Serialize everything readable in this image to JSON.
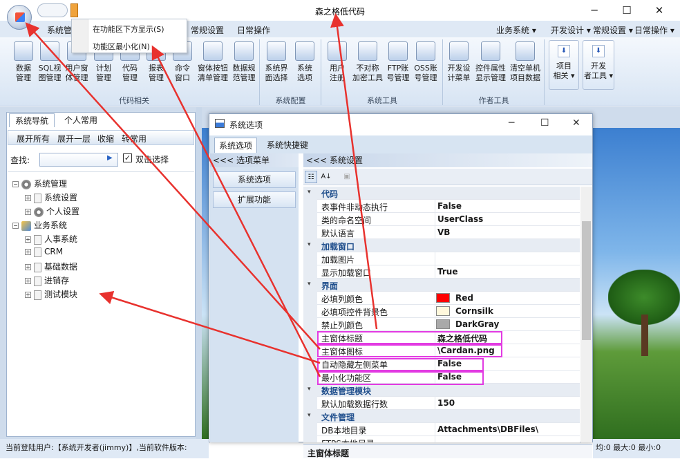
{
  "window": {
    "title": "森之格低代码",
    "minimize": "─",
    "maximize": "☐",
    "close": "✕"
  },
  "popup_menu": [
    "在功能区下方显示(S)",
    "功能区最小化(N)"
  ],
  "ribbon_tabs": [
    "系统管",
    "常规设置",
    "日常操作"
  ],
  "ribbon_right": [
    "业务系统 ▾",
    "开发设计 ▾",
    "常规设置 ▾",
    "日常操作 ▾"
  ],
  "groups": [
    {
      "label": "代码相关",
      "buttons": [
        "数据\n管理",
        "SQL视\n图管理",
        "用户窗\n体管理",
        "计划\n管理",
        "代码\n管理",
        "报表\n管理",
        "命令\n窗口",
        "窗体按钮\n清单管理",
        "数据规\n范管理"
      ]
    },
    {
      "label": "系统配置",
      "buttons": [
        "系统界\n面选择",
        "系统\n选项"
      ]
    },
    {
      "label": "系统工具",
      "buttons": [
        "用户\n注册",
        "不对称\n加密工具",
        "FTP账\n号管理",
        "OSS账\n号管理"
      ]
    },
    {
      "label": "作者工具",
      "buttons": [
        "开发设\n计菜单",
        "控件属性\n显示管理",
        "清空单机\n项目数据"
      ]
    }
  ],
  "big_buttons": [
    "项目\n相关 ▾",
    "开发\n者工具 ▾"
  ],
  "left_tabs": [
    "系统导航",
    "个人常用"
  ],
  "nav_buttons": [
    "展开所有",
    "展开一层",
    "收缩",
    "转常用"
  ],
  "find_label": "查找:",
  "dblclick_label": "双击选择",
  "tree": [
    {
      "label": "系统管理",
      "level": 0,
      "icon": "gear"
    },
    {
      "label": "系统设置",
      "level": 1,
      "icon": "doc"
    },
    {
      "label": "个人设置",
      "level": 1,
      "icon": "gear"
    },
    {
      "label": "业务系统",
      "level": 0,
      "icon": "biz"
    },
    {
      "label": "人事系统",
      "level": 1,
      "icon": "doc"
    },
    {
      "label": "CRM",
      "level": 1,
      "icon": "doc"
    },
    {
      "label": "基础数据",
      "level": 1,
      "icon": "doc"
    },
    {
      "label": "进销存",
      "level": 1,
      "icon": "doc"
    },
    {
      "label": "测试模块",
      "level": 1,
      "icon": "doc"
    }
  ],
  "dialog": {
    "title": "系统选项",
    "tabs": [
      "系统选项",
      "系统快捷键"
    ],
    "menu_header": "<<< 选项菜单",
    "settings_header": "<<< 系统设置",
    "menu_items": [
      "系统选项",
      "扩展功能"
    ],
    "description_title": "主窗体标题"
  },
  "properties": [
    {
      "type": "cat",
      "name": "代码"
    },
    {
      "name": "表事件非动态执行",
      "value": "False"
    },
    {
      "name": "类的命名空间",
      "value": "UserClass"
    },
    {
      "name": "默认语言",
      "value": "VB"
    },
    {
      "type": "cat",
      "name": "加载窗口"
    },
    {
      "name": "加载图片",
      "value": ""
    },
    {
      "name": "显示加载窗口",
      "value": "True"
    },
    {
      "type": "cat",
      "name": "界面"
    },
    {
      "name": "必填列颜色",
      "value": "Red",
      "swatch": "#ff0000"
    },
    {
      "name": "必填项控件背景色",
      "value": "Cornsilk",
      "swatch": "#fff8dc"
    },
    {
      "name": "禁止列颜色",
      "value": "DarkGray",
      "swatch": "#a9a9a9"
    },
    {
      "name": "主窗体标题",
      "value": "森之格低代码"
    },
    {
      "name": "主窗体图标",
      "value": "\\Cardan.png"
    },
    {
      "name": "自动隐藏左侧菜单",
      "value": "False"
    },
    {
      "name": "最小化功能区",
      "value": "False"
    },
    {
      "type": "cat",
      "name": "数据管理模块"
    },
    {
      "name": "默认加载数据行数",
      "value": "150"
    },
    {
      "type": "cat",
      "name": "文件管理"
    },
    {
      "name": "DB本地目录",
      "value": "Attachments\\DBFiles\\"
    },
    {
      "name": "FTPS本地目录",
      "value": ""
    }
  ],
  "status_left": "当前登陆用户:【系统开发者(jimmy)】,当前软件版本:",
  "status_right": "均:0 最大:0 最小:0",
  "highlight_color": "#e23be2",
  "arrow_color": "#e8322e"
}
